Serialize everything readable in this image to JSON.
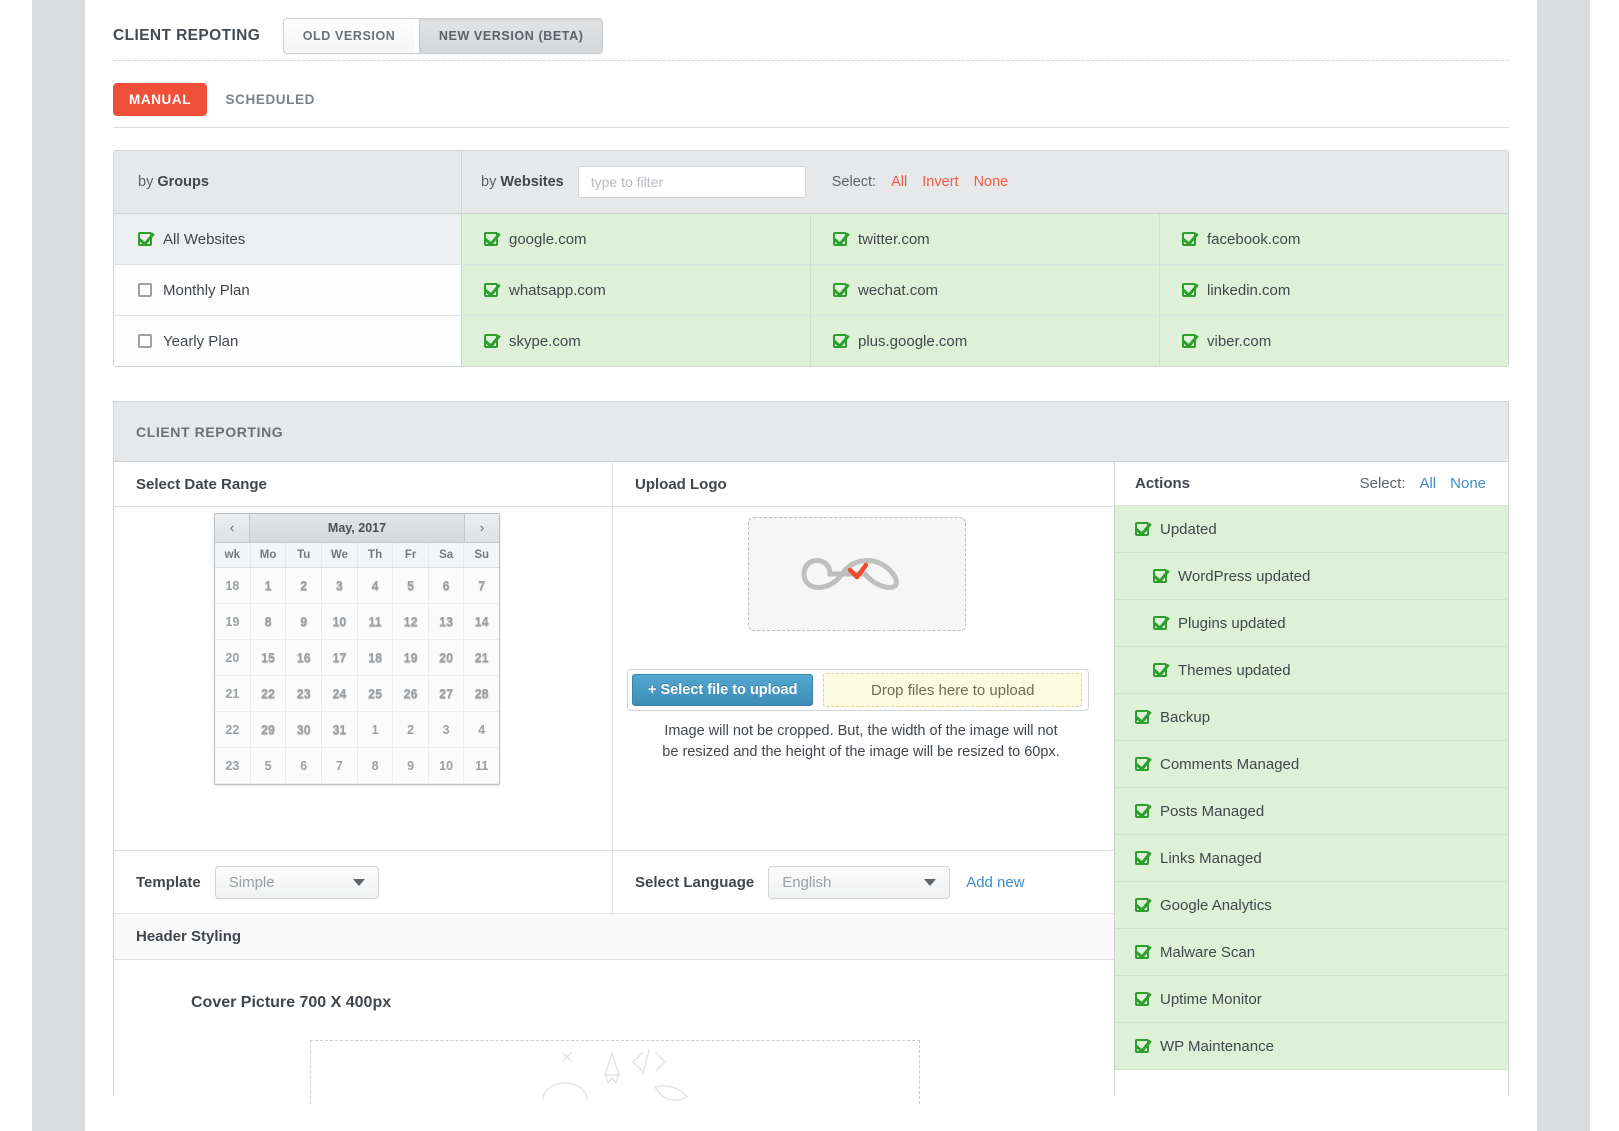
{
  "header": {
    "title": "CLIENT REPOTING",
    "version_tabs": [
      {
        "label": "OLD VERSION",
        "active": false
      },
      {
        "label": "NEW VERSION (BETA)",
        "active": true
      }
    ]
  },
  "mode_tabs": [
    {
      "label": "MANUAL",
      "active": true
    },
    {
      "label": "SCHEDULED",
      "active": false
    }
  ],
  "selector": {
    "by_groups_prefix": "by ",
    "by_groups_strong": "Groups",
    "by_websites_prefix": "by ",
    "by_websites_strong": "Websites",
    "filter_placeholder": "type to filter",
    "filter_value": "",
    "select_label": "Select:",
    "select_all": "All",
    "select_invert": "Invert",
    "select_none": "None",
    "groups": [
      {
        "label": "All Websites",
        "checked": true,
        "selected": true
      },
      {
        "label": "Monthly Plan",
        "checked": false,
        "selected": false
      },
      {
        "label": "Yearly Plan",
        "checked": false,
        "selected": false
      }
    ],
    "websites": [
      {
        "label": "google.com",
        "checked": true
      },
      {
        "label": "twitter.com",
        "checked": true
      },
      {
        "label": "facebook.com",
        "checked": true
      },
      {
        "label": "whatsapp.com",
        "checked": true
      },
      {
        "label": "wechat.com",
        "checked": true
      },
      {
        "label": "linkedin.com",
        "checked": true
      },
      {
        "label": "skype.com",
        "checked": true
      },
      {
        "label": "plus.google.com",
        "checked": true
      },
      {
        "label": "viber.com",
        "checked": true
      }
    ]
  },
  "panel": {
    "title": "CLIENT REPORTING",
    "date_range_header": "Select Date Range",
    "upload_logo_header": "Upload Logo"
  },
  "calendar": {
    "prev_icon": "‹",
    "next_icon": "›",
    "month_label": "May, 2017",
    "weekday_headers": [
      "wk",
      "Mo",
      "Tu",
      "We",
      "Th",
      "Fr",
      "Sa",
      "Su"
    ],
    "weeks": [
      {
        "wk": "18",
        "days": [
          {
            "n": "1",
            "state": "sel"
          },
          {
            "n": "2",
            "state": "sel"
          },
          {
            "n": "3",
            "state": "sel"
          },
          {
            "n": "4",
            "state": "sel"
          },
          {
            "n": "5",
            "state": "sel"
          },
          {
            "n": "6",
            "state": "sel"
          },
          {
            "n": "7",
            "state": "sel"
          }
        ]
      },
      {
        "wk": "19",
        "days": [
          {
            "n": "8",
            "state": "sel"
          },
          {
            "n": "9",
            "state": "sel"
          },
          {
            "n": "10",
            "state": "sel"
          },
          {
            "n": "11",
            "state": "sel"
          },
          {
            "n": "12",
            "state": "sel"
          },
          {
            "n": "13",
            "state": "sel"
          },
          {
            "n": "14",
            "state": "sel"
          }
        ]
      },
      {
        "wk": "20",
        "days": [
          {
            "n": "15",
            "state": "sel"
          },
          {
            "n": "16",
            "state": "sel"
          },
          {
            "n": "17",
            "state": "sel"
          },
          {
            "n": "18",
            "state": "sel"
          },
          {
            "n": "19",
            "state": "sel"
          },
          {
            "n": "20",
            "state": "sel"
          },
          {
            "n": "21",
            "state": "sel"
          }
        ]
      },
      {
        "wk": "21",
        "days": [
          {
            "n": "22",
            "state": "sel"
          },
          {
            "n": "23",
            "state": "sel"
          },
          {
            "n": "24",
            "state": "sel"
          },
          {
            "n": "25",
            "state": "sel"
          },
          {
            "n": "26",
            "state": "sel"
          },
          {
            "n": "27",
            "state": "sel"
          },
          {
            "n": "28",
            "state": "sel"
          }
        ]
      },
      {
        "wk": "22",
        "days": [
          {
            "n": "29",
            "state": "sel"
          },
          {
            "n": "30",
            "state": "sel"
          },
          {
            "n": "31",
            "state": "sel"
          },
          {
            "n": "1",
            "state": "out"
          },
          {
            "n": "2",
            "state": "out"
          },
          {
            "n": "3",
            "state": "out"
          },
          {
            "n": "4",
            "state": "out"
          }
        ]
      },
      {
        "wk": "23",
        "days": [
          {
            "n": "5",
            "state": "faded"
          },
          {
            "n": "6",
            "state": "faded"
          },
          {
            "n": "7",
            "state": "faded"
          },
          {
            "n": "8",
            "state": "faded"
          },
          {
            "n": "9",
            "state": "faded"
          },
          {
            "n": "10",
            "state": "faded"
          },
          {
            "n": "11",
            "state": "faded"
          }
        ]
      }
    ]
  },
  "upload": {
    "logo_alt": "infinity-logo",
    "select_file_label": "+ Select file to upload",
    "drop_label": "Drop files here to upload",
    "note_line1": "Image will not be cropped. But, the width of the image will not",
    "note_line2": "be resized and the height of the image will be resized to 60px."
  },
  "template_row": {
    "template_label": "Template",
    "template_value": "Simple",
    "language_label": "Select Language",
    "language_value": "English",
    "add_new_label": "Add new"
  },
  "header_styling": {
    "section_title": "Header Styling",
    "cover_title": "Cover Picture 700 X 400px"
  },
  "actions": {
    "title": "Actions",
    "select_label": "Select:",
    "select_all": "All",
    "select_none": "None",
    "items": [
      {
        "label": "Updated",
        "checked": true,
        "sub": false
      },
      {
        "label": "WordPress updated",
        "checked": true,
        "sub": true
      },
      {
        "label": "Plugins updated",
        "checked": true,
        "sub": true
      },
      {
        "label": "Themes updated",
        "checked": true,
        "sub": true
      },
      {
        "label": "Backup",
        "checked": true,
        "sub": false
      },
      {
        "label": "Comments Managed",
        "checked": true,
        "sub": false
      },
      {
        "label": "Posts Managed",
        "checked": true,
        "sub": false
      },
      {
        "label": "Links Managed",
        "checked": true,
        "sub": false
      },
      {
        "label": "Google Analytics",
        "checked": true,
        "sub": false
      },
      {
        "label": "Malware Scan",
        "checked": true,
        "sub": false
      },
      {
        "label": "Uptime Monitor",
        "checked": true,
        "sub": false
      },
      {
        "label": "WP Maintenance",
        "checked": true,
        "sub": false
      }
    ]
  },
  "colors": {
    "accent_red": "#f0503a",
    "link_red": "#ef5b43",
    "link_blue": "#3f8dc8",
    "checkbox_green": "#2c9f2c",
    "row_green_bg": "#dff0d8",
    "calendar_selected": "#2ba3d4",
    "rail_gray": "#dadee1"
  }
}
